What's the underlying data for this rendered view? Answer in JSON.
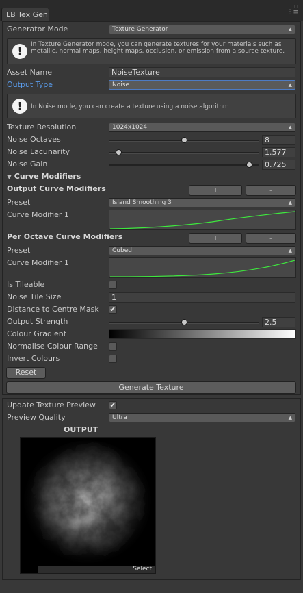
{
  "window": {
    "tab_title": "LB Tex Gen",
    "menu_glyph": "▫\n⋮≡"
  },
  "generator_mode": {
    "label": "Generator Mode",
    "value": "Texture Generator",
    "help_icon": "!",
    "help": "In Texture Generator mode, you can generate textures for your materials such as metallic, normal maps, height maps, occlusion, or emission from a source texture."
  },
  "asset_name": {
    "label": "Asset Name",
    "value": "NoiseTexture"
  },
  "output_type": {
    "label": "Output Type",
    "value": "Noise",
    "help_icon": "!",
    "help": "In Noise mode, you can create a texture using a noise algorithm"
  },
  "texture_resolution": {
    "label": "Texture Resolution",
    "value": "1024x1024"
  },
  "noise_octaves": {
    "label": "Noise Octaves",
    "value": "8",
    "slider_fraction": 0.5
  },
  "noise_lacunarity": {
    "label": "Noise Lacunarity",
    "value": "1.577",
    "slider_fraction": 0.06
  },
  "noise_gain": {
    "label": "Noise Gain",
    "value": "0.725",
    "slider_fraction": 0.94
  },
  "curve_modifiers": {
    "foldout_arrow": "▼",
    "title": "Curve Modifiers",
    "output_section": {
      "title": "Output Curve Modifiers",
      "add": "+",
      "remove": "-",
      "preset_label": "Preset",
      "preset_value": "Island Smoothing 3",
      "curve_label": "Curve Modifier 1"
    },
    "per_octave_section": {
      "title": "Per Octave Curve Modifiers",
      "add": "+",
      "remove": "-",
      "preset_label": "Preset",
      "preset_value": "Cubed",
      "curve_label": "Curve Modifier 1"
    }
  },
  "is_tileable": {
    "label": "Is Tileable",
    "checked": false
  },
  "noise_tile_size": {
    "label": "Noise Tile Size",
    "value": "1"
  },
  "distance_to_centre_mask": {
    "label": "Distance to Centre Mask",
    "checked": true,
    "check_glyph": "✔"
  },
  "output_strength": {
    "label": "Output Strength",
    "value": "2.5",
    "slider_fraction": 0.5
  },
  "colour_gradient": {
    "label": "Colour Gradient",
    "start_color": "#000000",
    "end_color": "#ffffff"
  },
  "normalise_colour_range": {
    "label": "Normalise Colour Range",
    "checked": false
  },
  "invert_colours": {
    "label": "Invert Colours",
    "checked": false
  },
  "reset_button": "Reset",
  "generate_button": "Generate Texture",
  "preview": {
    "update_label": "Update Texture Preview",
    "update_checked": true,
    "check_glyph": "✔",
    "quality_label": "Preview Quality",
    "quality_value": "Ultra",
    "output_title": "OUTPUT",
    "select_label": "Select"
  },
  "colors": {
    "curve_line": "#3ee83e",
    "accent_blue": "#5a9bea",
    "panel": "#383838"
  },
  "icons": [
    "dropdown-arrow-icon",
    "help-exclamation-icon",
    "foldout-triangle-icon",
    "checkmark-icon",
    "window-menu-icon"
  ]
}
